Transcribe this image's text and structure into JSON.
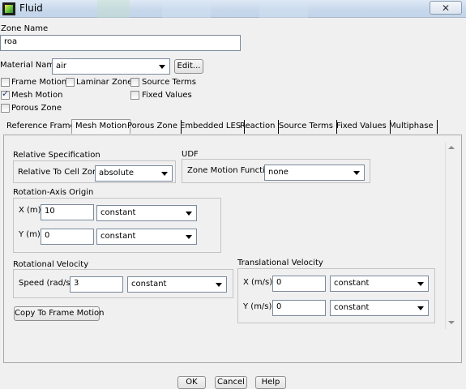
{
  "window": {
    "title": "Fluid",
    "close_glyph": "✕"
  },
  "zone_name": {
    "label": "Zone Name",
    "value": "roa"
  },
  "material": {
    "label": "Material Name",
    "value": "air",
    "edit_label": "Edit..."
  },
  "options": {
    "frame_motion": {
      "label": "Frame Motion",
      "checked": false
    },
    "laminar_zone": {
      "label": "Laminar Zone",
      "checked": false
    },
    "source_terms": {
      "label": "Source Terms",
      "checked": false
    },
    "mesh_motion": {
      "label": "Mesh Motion",
      "checked": true
    },
    "fixed_values": {
      "label": "Fixed Values",
      "checked": false
    },
    "porous_zone": {
      "label": "Porous Zone",
      "checked": false
    }
  },
  "tabs": [
    {
      "label": "Reference Frame"
    },
    {
      "label": "Mesh Motion",
      "active": true
    },
    {
      "label": "Porous Zone"
    },
    {
      "label": "Embedded LES"
    },
    {
      "label": "Reaction"
    },
    {
      "label": "Source Terms"
    },
    {
      "label": "Fixed Values"
    },
    {
      "label": "Multiphase"
    }
  ],
  "mesh_motion": {
    "relative_spec": {
      "title": "Relative Specification",
      "label": "Relative To Cell Zone",
      "value": "absolute"
    },
    "udf": {
      "title": "UDF",
      "label": "Zone Motion Function",
      "value": "none"
    },
    "rotation_axis_origin": {
      "title": "Rotation-Axis Origin",
      "x": {
        "label": "X (m)",
        "value": "10",
        "method": "constant"
      },
      "y": {
        "label": "Y (m)",
        "value": "0",
        "method": "constant"
      }
    },
    "rotational_velocity": {
      "title": "Rotational Velocity",
      "speed": {
        "label": "Speed (rad/s)",
        "value": "3",
        "method": "constant"
      }
    },
    "translational_velocity": {
      "title": "Translational Velocity",
      "x": {
        "label": "X (m/s)",
        "value": "0",
        "method": "constant"
      },
      "y": {
        "label": "Y (m/s)",
        "value": "0",
        "method": "constant"
      }
    },
    "copy_button": "Copy To Frame Motion"
  },
  "footer": {
    "ok": "OK",
    "cancel": "Cancel",
    "help": "Help"
  }
}
